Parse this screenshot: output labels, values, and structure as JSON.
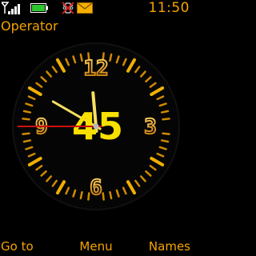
{
  "status": {
    "time": "11:50",
    "signal_icon": "signal-strength-icon",
    "battery_icon": "battery-icon",
    "vibrate_icon": "vibrate-off-icon",
    "message_icon": "new-message-icon"
  },
  "operator": "Operator",
  "clock": {
    "dial_numerals": {
      "twelve": "12",
      "three": "3",
      "six": "6",
      "nine": "9"
    },
    "digital_minute": "45",
    "hour_hand_value": 11.83,
    "minute_hand_value": 50,
    "second_hand_value": 45,
    "colors": {
      "gold": "#f0a000",
      "yellow": "#f8e000",
      "second_hand": "#d01010"
    }
  },
  "softkeys": {
    "left": "Go to",
    "middle": "Menu",
    "right": "Names"
  }
}
